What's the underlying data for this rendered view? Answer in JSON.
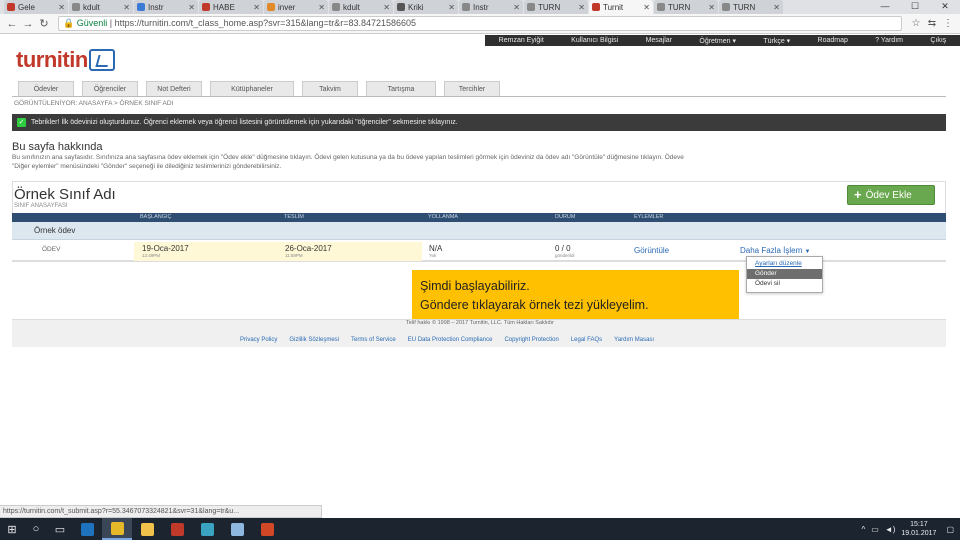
{
  "browser": {
    "tabs": [
      {
        "label": "Gele",
        "color": "#c0392b"
      },
      {
        "label": "kdult",
        "color": "#888888"
      },
      {
        "label": "Instr",
        "color": "#3a7bd5"
      },
      {
        "label": "HABE",
        "color": "#c0392b"
      },
      {
        "label": "inver",
        "color": "#e08a2a"
      },
      {
        "label": "kdult",
        "color": "#888888"
      },
      {
        "label": "Kriki",
        "color": "#555555"
      },
      {
        "label": "Instr",
        "color": "#888888"
      },
      {
        "label": "TURN",
        "color": "#888888"
      },
      {
        "label": "Turnit",
        "color": "#c0392b"
      },
      {
        "label": "TURN",
        "color": "#888888"
      },
      {
        "label": "TURN",
        "color": "#888888"
      }
    ],
    "secure_label": "Güvenli",
    "url": "https://turnitin.com/t_class_home.asp?svr=315&lang=tr&r=83.84721586605",
    "status_url": "https://turnitin.com/t_submit.asp?r=55.3467073324821&svr=31&lang=tr&u..."
  },
  "topnav": [
    "Remzan Eyiğit",
    "Kullanıcı Bilgisi",
    "Mesajlar",
    "Öğretmen ▾",
    "Türkçe ▾",
    "Roadmap",
    "? Yardım",
    "Çıkış"
  ],
  "logo": "turnitin",
  "page_tabs": [
    {
      "label": "Ödevler",
      "w": 56
    },
    {
      "label": "Öğrenciler",
      "w": 56
    },
    {
      "label": "Not Defteri",
      "w": 56
    },
    {
      "label": "Kütüphaneler",
      "w": 84
    },
    {
      "label": "Takvim",
      "w": 56
    },
    {
      "label": "Tartışma",
      "w": 70
    },
    {
      "label": "Tercihler",
      "w": 56
    }
  ],
  "breadcrumb": "GÖRÜNTÜLENİYOR: ANASAYFA > ÖRNEK SINIF ADI",
  "alert": "Tebrikler! İlk ödevinizi oluşturdunuz. Öğrenci eklemek veya öğrenci listesini görüntülemek için yukarıdaki \"öğrenciler\" sekmesine tıklayınız.",
  "about": {
    "heading": "Bu sayfa hakkında",
    "line1": "Bu sınıfınızın ana sayfasıdır. Sınıfınıza ana sayfasına ödev eklemek için \"Ödev ekle\" düğmesine tıklayın. Ödevi gelen kutusuna ya da bu ödeve yapılan teslimleri görmek için ödeviniz da ödev adı \"Görüntüle\" düğmesine tıklayın. Ödeve",
    "line2": "\"Diğer eylemler\" menüsündeki \"Gönder\" seçeneği ile dilediğiniz teslimlerinizi gönderebilirsiniz."
  },
  "class": {
    "title": "Örnek Sınıf Adı",
    "subtitle": "SINIF ANASAYFASI",
    "add_button": "Ödev Ekle"
  },
  "table": {
    "headers": [
      "BAŞLANGIÇ",
      "TESLİM",
      "YOLLANMA",
      "DURUM",
      "EYLEMLER"
    ],
    "group": "Örnek ödev",
    "row": {
      "type": "ÖDEV",
      "start": "19-Oca-2017",
      "start_time": "12:49PM",
      "due": "26-Oca-2017",
      "due_time": "11:59PM",
      "post": "N/A",
      "post_sub": "Yok",
      "status": "0 / 0",
      "status_sub": "gönderildi",
      "view": "Görüntüle",
      "more": "Daha Fazla İşlem"
    }
  },
  "dropdown": [
    "Ayarları düzenle",
    "Gönder",
    "Ödevi sil"
  ],
  "callout": {
    "line1": "Şimdi başlayabiliriz.",
    "line2": "Göndere tıklayarak örnek tezi yükleyelim."
  },
  "footer": {
    "copyright": "Telif hakkı © 1998 – 2017 Turnitin, LLC. Tüm Hakları Saklıdır",
    "links": [
      "Privacy Policy",
      "Gizlilik Sözleşmesi",
      "Terms of Service",
      "EU Data Protection Compliance",
      "Copyright Protection",
      "Legal FAQs",
      "Yardım Masası"
    ]
  },
  "taskbar": {
    "time": "15:17",
    "date": "19.01.2017",
    "apps": [
      {
        "name": "ie-app-icon",
        "color": "#1e73be"
      },
      {
        "name": "chrome-app-icon",
        "color": "#e6b92a",
        "active": true
      },
      {
        "name": "explorer-app-icon",
        "color": "#f0c14b"
      },
      {
        "name": "filezilla-app-icon",
        "color": "#c0392b"
      },
      {
        "name": "app-icon",
        "color": "#3aa3c2"
      },
      {
        "name": "box-app-icon",
        "color": "#8fb8e0"
      },
      {
        "name": "powerpoint-app-icon",
        "color": "#d24726"
      }
    ]
  }
}
